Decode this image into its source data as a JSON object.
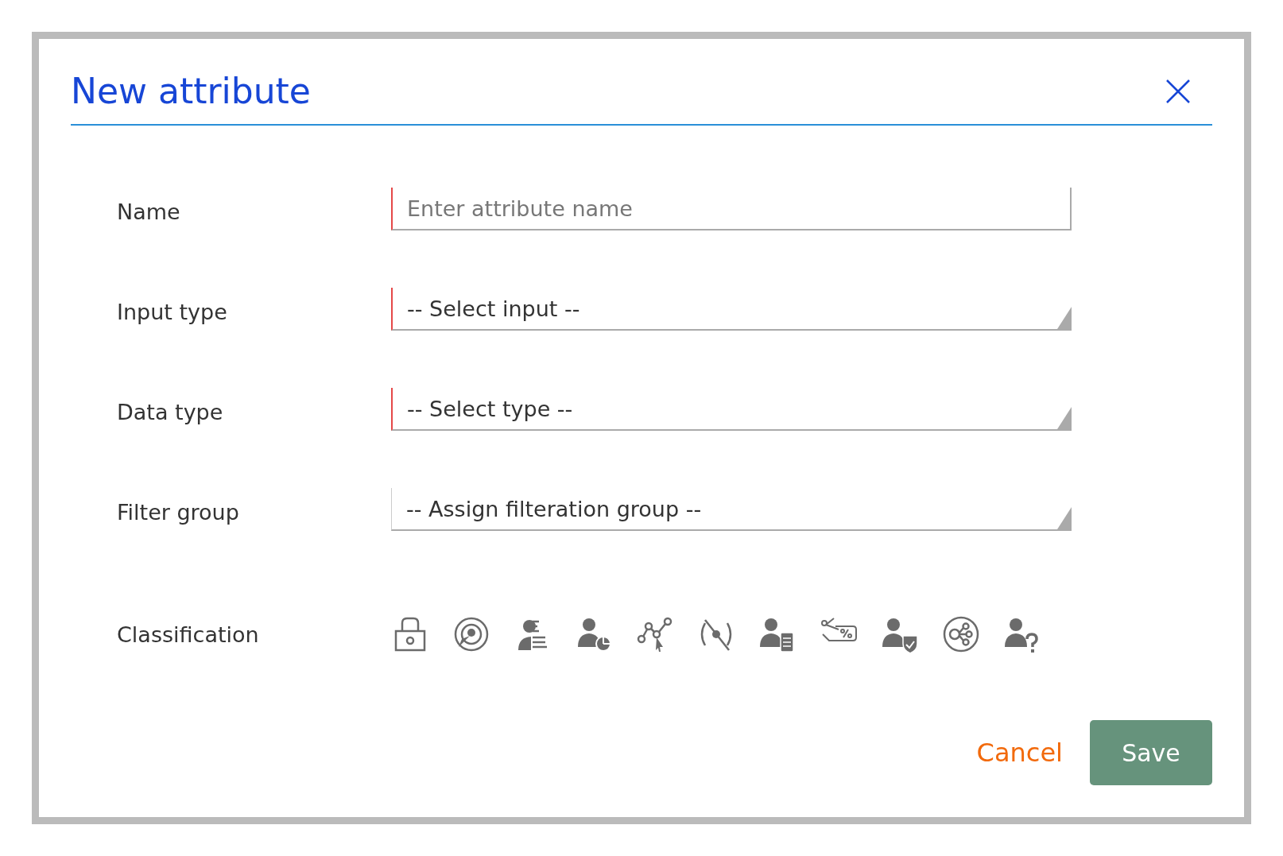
{
  "dialog": {
    "title": "New attribute"
  },
  "fields": [
    {
      "label": "Name",
      "kind": "text",
      "placeholder": "Enter attribute name",
      "required": true
    },
    {
      "label": "Input type",
      "kind": "select",
      "value": "-- Select input --",
      "required": true
    },
    {
      "label": "Data type",
      "kind": "select",
      "value": "-- Select type --",
      "required": true
    },
    {
      "label": "Filter group",
      "kind": "select",
      "value": "-- Assign filteration group --",
      "required": false
    }
  ],
  "classification": {
    "label": "Classification"
  },
  "buttons": {
    "cancel": "Cancel",
    "save": "Save"
  }
}
